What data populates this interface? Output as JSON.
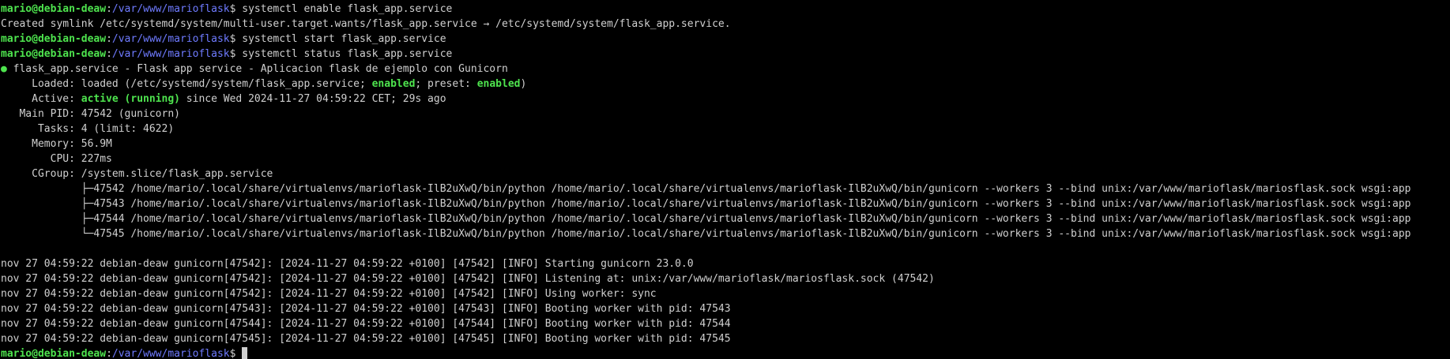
{
  "prompt": {
    "user_host": "mario@debian-deaw",
    "colon": ":",
    "path": "/var/www/marioflask",
    "dollar": "$ "
  },
  "commands": {
    "enable": "systemctl enable flask_app.service",
    "start": "systemctl start flask_app.service",
    "status": "systemctl status flask_app.service"
  },
  "symlink_line": "Created symlink /etc/systemd/system/multi-user.target.wants/flask_app.service → /etc/systemd/system/flask_app.service.",
  "status": {
    "dot": "●",
    "header": " flask_app.service - Flask app service - Aplicacion flask de ejemplo con Gunicorn",
    "loaded_label": "     Loaded: ",
    "loaded_pre": "loaded (/etc/systemd/system/flask_app.service; ",
    "loaded_enabled": "enabled",
    "loaded_mid": "; preset: ",
    "loaded_preset": "enabled",
    "loaded_post": ")",
    "active_label": "     Active: ",
    "active_state": "active (running)",
    "active_rest": " since Wed 2024-11-27 04:59:22 CET; 29s ago",
    "mainpid": "   Main PID: 47542 (gunicorn)",
    "tasks": "      Tasks: 4 (limit: 4622)",
    "memory": "     Memory: 56.9M",
    "cpu": "        CPU: 227ms",
    "cgroup": "     CGroup: /system.slice/flask_app.service",
    "processes": [
      "             ├─47542 /home/mario/.local/share/virtualenvs/marioflask-IlB2uXwQ/bin/python /home/mario/.local/share/virtualenvs/marioflask-IlB2uXwQ/bin/gunicorn --workers 3 --bind unix:/var/www/marioflask/mariosflask.sock wsgi:app",
      "             ├─47543 /home/mario/.local/share/virtualenvs/marioflask-IlB2uXwQ/bin/python /home/mario/.local/share/virtualenvs/marioflask-IlB2uXwQ/bin/gunicorn --workers 3 --bind unix:/var/www/marioflask/mariosflask.sock wsgi:app",
      "             ├─47544 /home/mario/.local/share/virtualenvs/marioflask-IlB2uXwQ/bin/python /home/mario/.local/share/virtualenvs/marioflask-IlB2uXwQ/bin/gunicorn --workers 3 --bind unix:/var/www/marioflask/mariosflask.sock wsgi:app",
      "             └─47545 /home/mario/.local/share/virtualenvs/marioflask-IlB2uXwQ/bin/python /home/mario/.local/share/virtualenvs/marioflask-IlB2uXwQ/bin/gunicorn --workers 3 --bind unix:/var/www/marioflask/mariosflask.sock wsgi:app"
    ]
  },
  "logs": [
    "nov 27 04:59:22 debian-deaw gunicorn[47542]: [2024-11-27 04:59:22 +0100] [47542] [INFO] Starting gunicorn 23.0.0",
    "nov 27 04:59:22 debian-deaw gunicorn[47542]: [2024-11-27 04:59:22 +0100] [47542] [INFO] Listening at: unix:/var/www/marioflask/mariosflask.sock (47542)",
    "nov 27 04:59:22 debian-deaw gunicorn[47542]: [2024-11-27 04:59:22 +0100] [47542] [INFO] Using worker: sync",
    "nov 27 04:59:22 debian-deaw gunicorn[47543]: [2024-11-27 04:59:22 +0100] [47543] [INFO] Booting worker with pid: 47543",
    "nov 27 04:59:22 debian-deaw gunicorn[47544]: [2024-11-27 04:59:22 +0100] [47544] [INFO] Booting worker with pid: 47544",
    "nov 27 04:59:22 debian-deaw gunicorn[47545]: [2024-11-27 04:59:22 +0100] [47545] [INFO] Booting worker with pid: 47545"
  ],
  "colors": {
    "background": "#000000",
    "text": "#d0d0d0",
    "prompt_user": "#4ee44e",
    "prompt_path": "#6f7bff",
    "status_ok": "#4ee44e"
  }
}
